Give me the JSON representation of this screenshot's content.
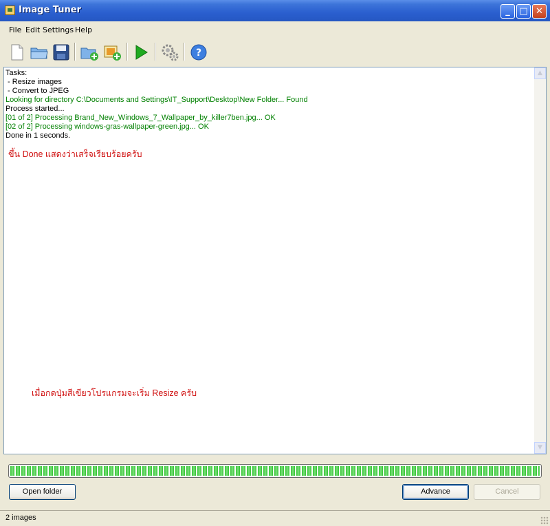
{
  "window": {
    "title": "Image Tuner"
  },
  "menu": [
    "File",
    "Edit",
    "Settings",
    "Help"
  ],
  "toolbar_icons": [
    "new-file-icon",
    "open-folder-icon",
    "save-icon",
    "add-folder-icon",
    "add-image-icon",
    "play-icon",
    "settings-gear-icon",
    "help-icon"
  ],
  "log": {
    "lines": [
      {
        "text": "Tasks:",
        "color": "#000000"
      },
      {
        "text": " - Resize images",
        "color": "#000000"
      },
      {
        "text": " - Convert to JPEG",
        "color": "#000000"
      },
      {
        "text": "Looking for directory C:\\Documents and Settings\\IT_Support\\Desktop\\New Folder... Found",
        "color": "#008000"
      },
      {
        "text": "Process started...",
        "color": "#000000"
      },
      {
        "text": "[01 of 2] Processing Brand_New_Windows_7_Wallpaper_by_killer7ben.jpg... OK",
        "color": "#008000"
      },
      {
        "text": "[02 of 2] Processing windows-gras-wallpaper-green.jpg... OK",
        "color": "#008000"
      },
      {
        "text": "Done in 1 seconds.",
        "color": "#000000"
      }
    ]
  },
  "annotations": {
    "done_note": "ขึ้น Done แสดงว่าเสร็จเรียบร้อยครับ",
    "green_button_note": "เมื่อกดปุ่มสีเขียวโปรแกรมจะเริ่ม Resize ครับ"
  },
  "progress": {
    "value": 1.0
  },
  "buttons": {
    "open_folder": "Open folder",
    "advance": "Advance",
    "cancel": "Cancel"
  },
  "status": {
    "text": "2 images"
  },
  "colors": {
    "titlebar": "#2a5fcf",
    "log_green": "#008000",
    "annotation_red": "#d01010",
    "progress_green": "#2fc22f"
  }
}
